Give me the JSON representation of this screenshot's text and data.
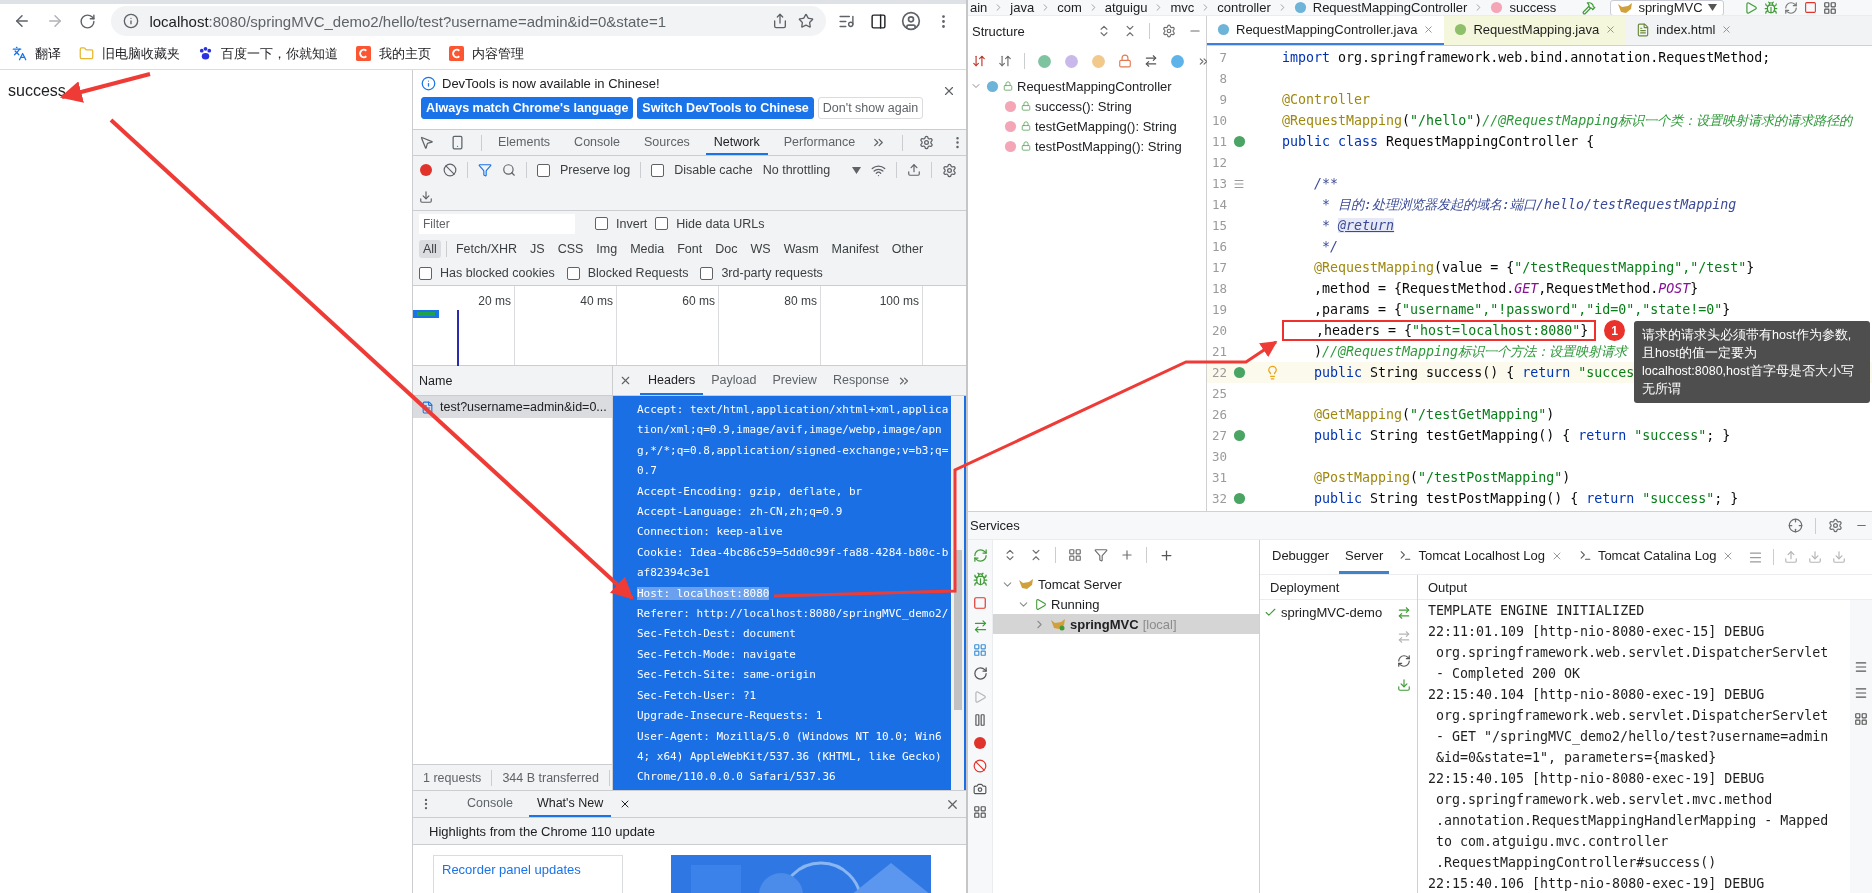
{
  "browser": {
    "url": {
      "host": "localhost",
      "rest": ":8080/springMVC_demo2/hello/test?username=admin&id=0&state=1"
    },
    "bookmarks": [
      {
        "label": "翻译",
        "kind": "translate"
      },
      {
        "label": "旧电脑收藏夹",
        "kind": "folder"
      },
      {
        "label": "百度一下，你就知道",
        "kind": "paw"
      },
      {
        "label": "我的主页",
        "kind": "red"
      },
      {
        "label": "内容管理",
        "kind": "red"
      }
    ],
    "page_text": "success"
  },
  "devtools": {
    "infobar": {
      "message": "DevTools is now available in Chinese!",
      "buttons": [
        {
          "label": "Always match Chrome's language",
          "primary": true
        },
        {
          "label": "Switch DevTools to Chinese",
          "primary": true
        },
        {
          "label": "Don't show again",
          "primary": false
        }
      ]
    },
    "tabs": [
      {
        "label": "Elements",
        "selected": false
      },
      {
        "label": "Console",
        "selected": false
      },
      {
        "label": "Sources",
        "selected": false
      },
      {
        "label": "Network",
        "selected": true
      },
      {
        "label": "Performance",
        "selected": false
      }
    ],
    "toolbar_checks": [
      {
        "label": "Preserve log",
        "checked": false
      },
      {
        "label": "Disable cache",
        "checked": false
      }
    ],
    "throttling": "No throttling",
    "filter_placeholder": "Filter",
    "filter_checks": [
      {
        "label": "Invert",
        "checked": false
      },
      {
        "label": "Hide data URLs",
        "checked": false
      }
    ],
    "types": [
      {
        "label": "All",
        "selected": true
      },
      {
        "label": "Fetch/XHR",
        "selected": false
      },
      {
        "label": "JS",
        "selected": false
      },
      {
        "label": "CSS",
        "selected": false
      },
      {
        "label": "Img",
        "selected": false
      },
      {
        "label": "Media",
        "selected": false
      },
      {
        "label": "Font",
        "selected": false
      },
      {
        "label": "Doc",
        "selected": false
      },
      {
        "label": "WS",
        "selected": false
      },
      {
        "label": "Wasm",
        "selected": false
      },
      {
        "label": "Manifest",
        "selected": false
      },
      {
        "label": "Other",
        "selected": false
      }
    ],
    "blocked_checks": [
      {
        "label": "Has blocked cookies",
        "checked": false
      },
      {
        "label": "Blocked Requests",
        "checked": false
      },
      {
        "label": "3rd-party requests",
        "checked": false
      }
    ],
    "timeline_ticks": [
      "20 ms",
      "40 ms",
      "60 ms",
      "80 ms",
      "100 ms"
    ],
    "name_header": "Name",
    "requests": [
      {
        "name": "test?username=admin&id=0...",
        "selected": true
      }
    ],
    "summary": [
      "1 requests",
      "344 B transferred"
    ],
    "detail_tabs": [
      {
        "label": "Headers",
        "selected": true
      },
      {
        "label": "Payload",
        "selected": false
      },
      {
        "label": "Preview",
        "selected": false
      },
      {
        "label": "Response",
        "selected": false
      }
    ],
    "headers": [
      {
        "text": "Accept: text/html,application/xhtml+xml,application/xml;q=0.9,image/avif,image/webp,image/apng,*/*;q=0.8,application/signed-exchange;v=b3;q=0.7",
        "highlighted": false
      },
      {
        "text": "Accept-Encoding: gzip, deflate, br",
        "highlighted": false
      },
      {
        "text": "Accept-Language: zh-CN,zh;q=0.9",
        "highlighted": false
      },
      {
        "text": "Connection: keep-alive",
        "highlighted": false
      },
      {
        "text": "Cookie: Idea-4bc86c59=5dd0c99f-fa88-4284-b80c-baf82394c3e1",
        "highlighted": false
      },
      {
        "text": "Host: localhost:8080",
        "highlighted": true
      },
      {
        "text": "Referer: http://localhost:8080/springMVC_demo2/",
        "highlighted": false
      },
      {
        "text": "Sec-Fetch-Dest: document",
        "highlighted": false
      },
      {
        "text": "Sec-Fetch-Mode: navigate",
        "highlighted": false
      },
      {
        "text": "Sec-Fetch-Site: same-origin",
        "highlighted": false
      },
      {
        "text": "Sec-Fetch-User: ?1",
        "highlighted": false
      },
      {
        "text": "Upgrade-Insecure-Requests: 1",
        "highlighted": false
      },
      {
        "text": "User-Agent: Mozilla/5.0 (Windows NT 10.0; Win64; x64) AppleWebKit/537.36 (KHTML, like Gecko) Chrome/110.0.0.0 Safari/537.36",
        "highlighted": false
      }
    ],
    "drawer_tabs": [
      {
        "label": "Console",
        "selected": false
      },
      {
        "label": "What's New",
        "selected": true
      }
    ],
    "highlights_title": "Highlights from the Chrome 110 update",
    "card_link": "Recorder panel updates"
  },
  "ide": {
    "breadcrumbs": [
      {
        "label": "ain"
      },
      {
        "label": "java"
      },
      {
        "label": "com"
      },
      {
        "label": "atguigu"
      },
      {
        "label": "mvc"
      },
      {
        "label": "controller"
      },
      {
        "label": "RequestMappingController",
        "kind": "class"
      },
      {
        "label": "success",
        "kind": "method"
      }
    ],
    "run_config": "springMVC",
    "structure": {
      "title": "Structure",
      "tree": [
        {
          "label": "RequestMappingController",
          "kind": "class",
          "expanded": true,
          "children": [
            {
              "label": "success(): String",
              "kind": "method"
            },
            {
              "label": "testGetMapping(): String",
              "kind": "method"
            },
            {
              "label": "testPostMapping(): String",
              "kind": "method"
            }
          ]
        }
      ]
    },
    "editor_tabs": [
      {
        "label": "RequestMappingController.java",
        "kind": "class",
        "selected": true
      },
      {
        "label": "RequestMapping.java",
        "kind": "annotation",
        "selected": false
      },
      {
        "label": "index.html",
        "kind": "html",
        "selected": false
      }
    ],
    "code": [
      {
        "number": "7",
        "segments": [
          {
            "kind": "kw",
            "text": "import"
          },
          {
            "kind": "pl",
            "text": " org.springframework.web.bind.annotation.RequestMethod;"
          }
        ]
      },
      {
        "number": "8"
      },
      {
        "number": "9",
        "segments": [
          {
            "kind": "ann",
            "text": "@Controller"
          }
        ]
      },
      {
        "number": "10",
        "segments": [
          {
            "kind": "ann",
            "text": "@RequestMapping"
          },
          {
            "kind": "pl",
            "text": "("
          },
          {
            "kind": "str",
            "text": "\"/hello\""
          },
          {
            "kind": "pl",
            "text": ")"
          },
          {
            "kind": "cmt",
            "text": "//@RequestMapping标识一个类：设置映射请求的请求路径的"
          }
        ]
      },
      {
        "number": "11",
        "gutter": {
          "kind": "bean"
        },
        "segments": [
          {
            "kind": "kw",
            "text": "public class"
          },
          {
            "kind": "pl",
            "text": " RequestMappingController {"
          }
        ]
      },
      {
        "number": "12"
      },
      {
        "number": "13",
        "gutter": {
          "kind": "doc"
        },
        "segments": [
          {
            "kind": "doc",
            "text": "    /**"
          }
        ]
      },
      {
        "number": "14",
        "segments": [
          {
            "kind": "doc",
            "text": "     * 目的:处理浏览器发起的域名:端口/hello/testRequestMapping"
          }
        ]
      },
      {
        "number": "15",
        "segments": [
          {
            "kind": "doc",
            "text": "     * "
          },
          {
            "kind": "doctag",
            "text": "@return"
          }
        ]
      },
      {
        "number": "16",
        "segments": [
          {
            "kind": "doc",
            "text": "     */"
          }
        ]
      },
      {
        "number": "17",
        "segments": [
          {
            "kind": "ann",
            "text": "    @RequestMapping"
          },
          {
            "kind": "pl",
            "text": "(value = {"
          },
          {
            "kind": "str",
            "text": "\"/testRequestMapping\",\"/test\""
          },
          {
            "kind": "pl",
            "text": "}"
          }
        ]
      },
      {
        "number": "18",
        "segments": [
          {
            "kind": "pl",
            "text": "    ,method = {RequestMethod."
          },
          {
            "kind": "const",
            "text": "GET"
          },
          {
            "kind": "pl",
            "text": ",RequestMethod."
          },
          {
            "kind": "const",
            "text": "POST"
          },
          {
            "kind": "pl",
            "text": "}"
          }
        ]
      },
      {
        "number": "19",
        "segments": [
          {
            "kind": "pl",
            "text": "    ,params = {"
          },
          {
            "kind": "str",
            "text": "\"username\",\"!password\",\"id=0\",\"state!=0\""
          },
          {
            "kind": "pl",
            "text": "}"
          }
        ]
      },
      {
        "number": "20",
        "framed": true,
        "segments": [
          {
            "kind": "pl",
            "text": "    ,headers = {"
          },
          {
            "kind": "str",
            "text": "\"host=localhost:8080\""
          },
          {
            "kind": "pl",
            "text": "}"
          }
        ]
      },
      {
        "number": "21",
        "segments": [
          {
            "kind": "pl",
            "text": "    )"
          },
          {
            "kind": "cmt",
            "text": "//@RequestMapping标识一个方法：设置映射请求"
          }
        ]
      },
      {
        "number": "22",
        "gutter": {
          "kind": "bean"
        },
        "hint": true,
        "current": true,
        "segments": [
          {
            "kind": "kw",
            "text": "    public"
          },
          {
            "kind": "pl",
            "text": " String success() { "
          },
          {
            "kind": "kw",
            "text": "return"
          },
          {
            "kind": "str",
            "text": " \"succes"
          }
        ]
      },
      {
        "number": "25"
      },
      {
        "number": "26",
        "segments": [
          {
            "kind": "ann",
            "text": "    @GetMapping"
          },
          {
            "kind": "pl",
            "text": "("
          },
          {
            "kind": "str",
            "text": "\"/testGetMapping\""
          },
          {
            "kind": "pl",
            "text": ")"
          }
        ]
      },
      {
        "number": "27",
        "gutter": {
          "kind": "bean"
        },
        "segments": [
          {
            "kind": "kw",
            "text": "    public"
          },
          {
            "kind": "pl",
            "text": " String testGetMapping() { "
          },
          {
            "kind": "kw",
            "text": "return"
          },
          {
            "kind": "str",
            "text": " \"success\""
          },
          {
            "kind": "pl",
            "text": "; }"
          }
        ]
      },
      {
        "number": "30"
      },
      {
        "number": "31",
        "segments": [
          {
            "kind": "ann",
            "text": "    @PostMapping"
          },
          {
            "kind": "pl",
            "text": "("
          },
          {
            "kind": "str",
            "text": "\"/testPostMapping\""
          },
          {
            "kind": "pl",
            "text": ")"
          }
        ]
      },
      {
        "number": "32",
        "gutter": {
          "kind": "bean"
        },
        "segments": [
          {
            "kind": "kw",
            "text": "    public"
          },
          {
            "kind": "pl",
            "text": " String testPostMapping() { "
          },
          {
            "kind": "kw",
            "text": "return"
          },
          {
            "kind": "str",
            "text": " \"success\""
          },
          {
            "kind": "pl",
            "text": "; }"
          }
        ]
      }
    ],
    "annotation": {
      "badge": "1",
      "note": "请求的请求头必须带有host作为参数,且host的值一定要为localhost:8080,host首字母是否大小写无所谓"
    },
    "services": {
      "title": "Services",
      "tree": [
        {
          "label": "Tomcat Server",
          "kind": "server",
          "expanded": true,
          "selected": false,
          "children": [
            {
              "label": "Running",
              "kind": "state",
              "expanded": true,
              "selected": false,
              "children": [
                {
                  "label": "springMVC",
                  "suffix": "[local]",
                  "kind": "app",
                  "expanded": false,
                  "selected": true
                }
              ]
            }
          ]
        }
      ],
      "tabs": [
        {
          "label": "Debugger",
          "selected": false,
          "closable": false
        },
        {
          "label": "Server",
          "selected": true,
          "closable": false
        },
        {
          "label": "Tomcat Localhost Log",
          "selected": false,
          "closable": true
        },
        {
          "label": "Tomcat Catalina Log",
          "selected": false,
          "closable": true
        }
      ],
      "deployment_header": "Deployment",
      "deployments": [
        {
          "label": "springMVC-demo",
          "ok": true
        }
      ],
      "output_header": "Output",
      "output": [
        {
          "text": "TEMPLATE ENGINE INITIALIZED",
          "wrapped": false
        },
        {
          "text": "22:11:01.109 [http-nio-8080-exec-15] DEBUG",
          "wrapped": false
        },
        {
          "text": "org.springframework.web.servlet.DispatcherServlet",
          "wrapped": true
        },
        {
          "text": "- Completed 200 OK",
          "wrapped": true
        },
        {
          "text": "22:15:40.104 [http-nio-8080-exec-19] DEBUG",
          "wrapped": false
        },
        {
          "text": "org.springframework.web.servlet.DispatcherServlet",
          "wrapped": true
        },
        {
          "text": "- GET \"/springMVC_demo2/hello/test?username=admin",
          "wrapped": true
        },
        {
          "text": "&id=0&state=1\", parameters={masked}",
          "wrapped": true
        },
        {
          "text": "22:15:40.105 [http-nio-8080-exec-19] DEBUG",
          "wrapped": false
        },
        {
          "text": "org.springframework.web.servlet.mvc.method",
          "wrapped": true
        },
        {
          "text": ".annotation.RequestMappingHandlerMapping - Mapped",
          "wrapped": true
        },
        {
          "text": "to com.atguigu.mvc.controller",
          "wrapped": true
        },
        {
          "text": ".RequestMappingController#success()",
          "wrapped": true
        },
        {
          "text": "22:15:40.106 [http-nio-8080-exec-19] DEBUG",
          "wrapped": false
        }
      ]
    }
  }
}
